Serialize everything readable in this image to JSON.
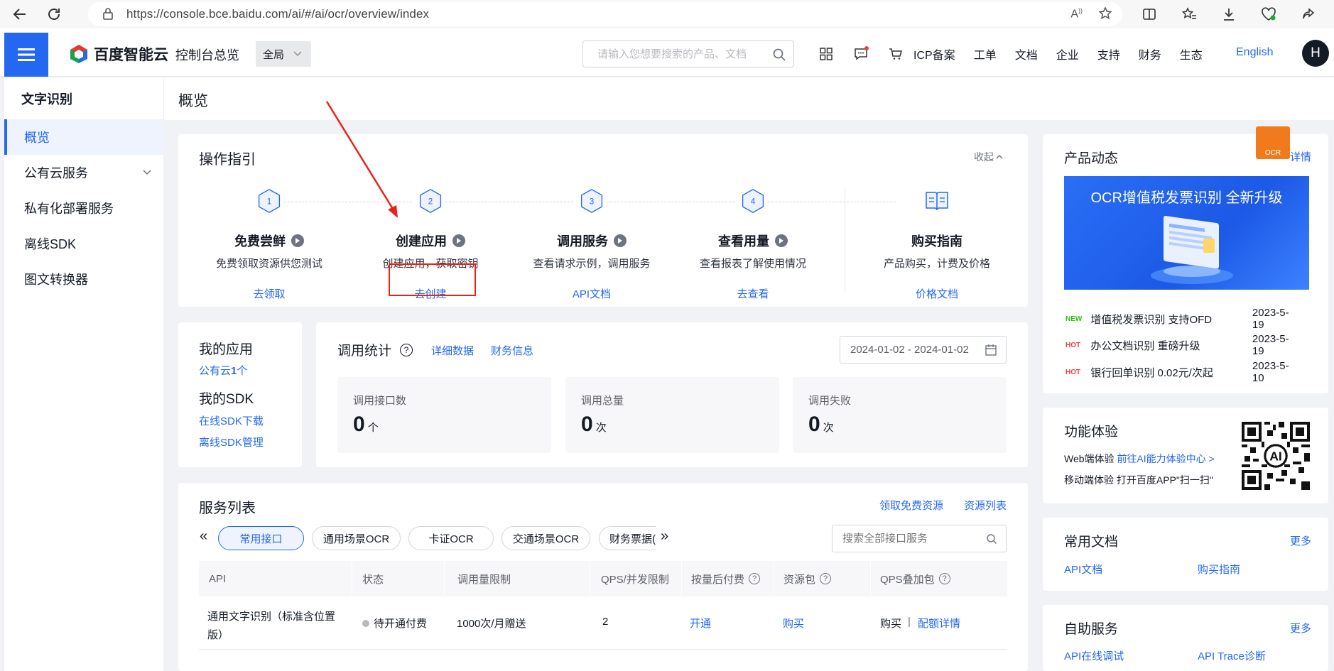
{
  "browser": {
    "url": "https://console.bce.baidu.com/ai/#/ai/ocr/overview/index"
  },
  "topnav": {
    "logo_text": "百度智能云",
    "console_label": "控制台总览",
    "region_label": "全局",
    "search_placeholder": "请输入您想要搜索的产品、文档",
    "links": [
      "ICP备案",
      "工单",
      "文档",
      "企业",
      "支持",
      "财务",
      "生态"
    ],
    "language_label": "English",
    "avatar_initial": "H"
  },
  "sidebar": {
    "title": "文字识别",
    "items": [
      {
        "label": "概览",
        "active": true
      },
      {
        "label": "公有云服务",
        "has_children": true
      },
      {
        "label": "私有化部署服务"
      },
      {
        "label": "离线SDK"
      },
      {
        "label": "图文转换器"
      }
    ]
  },
  "page": {
    "title": "概览"
  },
  "guide": {
    "title": "操作指引",
    "collapse_label": "收起",
    "steps": [
      {
        "number": "1",
        "title": "免费尝鲜",
        "desc": "免费领取资源供您测试",
        "link": "去领取"
      },
      {
        "number": "2",
        "title": "创建应用",
        "desc": "创建应用，获取密钥",
        "link": "去创建"
      },
      {
        "number": "3",
        "title": "调用服务",
        "desc": "查看请求示例，调用服务",
        "link": "API文档"
      },
      {
        "number": "4",
        "title": "查看用量",
        "desc": "查看报表了解使用情况",
        "link": "去查看"
      }
    ],
    "buy": {
      "title": "购买指南",
      "desc": "产品购买，计费及价格",
      "link": "价格文档"
    }
  },
  "myapps": {
    "apps_title": "我的应用",
    "apps_link_prefix": "公有云",
    "apps_count": "1",
    "apps_link_suffix": "个",
    "sdk_title": "我的SDK",
    "sdk_links": [
      "在线SDK下载",
      "离线SDK管理"
    ]
  },
  "stats": {
    "title": "调用统计",
    "help": "?",
    "links": [
      "详细数据",
      "财务信息"
    ],
    "date_range": "2024-01-02 - 2024-01-02",
    "boxes": [
      {
        "label": "调用接口数",
        "value": "0",
        "unit": "个"
      },
      {
        "label": "调用总量",
        "value": "0",
        "unit": "次"
      },
      {
        "label": "调用失败",
        "value": "0",
        "unit": "次"
      }
    ]
  },
  "services": {
    "title": "服务列表",
    "links": [
      "领取免费资源",
      "资源列表"
    ],
    "tabs": [
      {
        "label": "常用接口",
        "active": true
      },
      {
        "label": "通用场景OCR"
      },
      {
        "label": "卡证OCR"
      },
      {
        "label": "交通场景OCR"
      },
      {
        "label": "财务票据("
      }
    ],
    "prev_glyph": "«",
    "next_glyph": "»",
    "search_placeholder": "搜索全部接口服务",
    "columns": [
      "API",
      "状态",
      "调用量限制",
      "QPS/并发限制",
      "按量后付费",
      "资源包",
      "QPS叠加包"
    ],
    "rows": [
      {
        "api_line1": "通用文字识别（标准含位置",
        "api_line2": "版）",
        "status": "待开通付费",
        "limit": "1000次/月赠送",
        "qps": "2",
        "postpaid": "开通",
        "package": "购买",
        "qps_buy": "购买",
        "qps_sep": "|",
        "qps_detail": "配额详情"
      }
    ]
  },
  "right": {
    "news": {
      "title": "产品动态",
      "more": "详情",
      "banner_text": "OCR增值税发票识别 全新升级",
      "items": [
        {
          "tag": "NEW",
          "tag_color": "#30bf13",
          "text": "增值税发票识别 支持OFD",
          "date": "2023-5-19"
        },
        {
          "tag": "HOT",
          "tag_color": "#f33e3e",
          "text": "办公文档识别 重磅升级",
          "date": "2023-5-19"
        },
        {
          "tag": "HOT",
          "tag_color": "#f33e3e",
          "text": "银行回单识别 0.02元/次起",
          "date": "2023-5-10"
        }
      ]
    },
    "experience": {
      "title": "功能体验",
      "web_label": "Web端体验",
      "web_link": "前往AI能力体验中心 >",
      "mobile_text": "移动端体验 打开百度APP\"扫一扫\"",
      "qr_center": "AI"
    },
    "docs": {
      "title": "常用文档",
      "more": "更多",
      "links": [
        "API文档",
        "购买指南"
      ]
    },
    "selfservice": {
      "title": "自助服务",
      "more": "更多",
      "links": [
        "API在线调试",
        "API Trace诊断"
      ]
    },
    "floating_badge": "OCR"
  },
  "annotations": {
    "arrow_color": "#e8231b",
    "highlight_color": "#e8231b"
  },
  "colors": {
    "primary": "#2468f2",
    "text": "#151b26",
    "background": "#f0f2f5"
  }
}
